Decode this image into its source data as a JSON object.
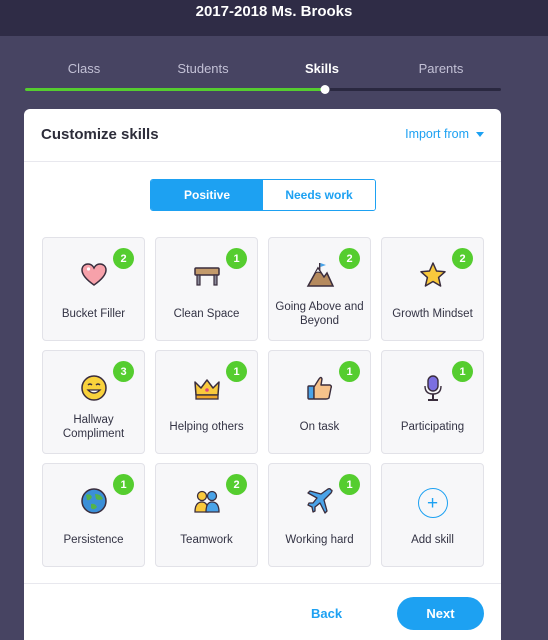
{
  "header": {
    "title": "2017-2018 Ms. Brooks"
  },
  "steps": {
    "items": [
      {
        "label": "Class"
      },
      {
        "label": "Students"
      },
      {
        "label": "Skills"
      },
      {
        "label": "Parents"
      }
    ],
    "active_index": 2,
    "progress_percent": 63
  },
  "card": {
    "title": "Customize skills",
    "import_label": "Import from",
    "toggle": {
      "positive_label": "Positive",
      "needs_work_label": "Needs work",
      "selected": "Positive"
    },
    "skills": [
      {
        "label": "Bucket Filler",
        "points": "2",
        "icon": "heart-icon"
      },
      {
        "label": "Clean Space",
        "points": "1",
        "icon": "desk-icon"
      },
      {
        "label": "Going Above and Beyond",
        "points": "2",
        "icon": "mountain-icon"
      },
      {
        "label": "Growth Mindset",
        "points": "2",
        "icon": "star-icon"
      },
      {
        "label": "Hallway Compliment",
        "points": "3",
        "icon": "smiley-icon"
      },
      {
        "label": "Helping others",
        "points": "1",
        "icon": "crown-icon"
      },
      {
        "label": "On task",
        "points": "1",
        "icon": "thumbs-up-icon"
      },
      {
        "label": "Participating",
        "points": "1",
        "icon": "microphone-icon"
      },
      {
        "label": "Persistence",
        "points": "1",
        "icon": "globe-icon"
      },
      {
        "label": "Teamwork",
        "points": "2",
        "icon": "team-icon"
      },
      {
        "label": "Working hard",
        "points": "1",
        "icon": "airplane-icon"
      }
    ],
    "add_skill_label": "Add skill",
    "add_icon": "plus-icon",
    "back_label": "Back",
    "next_label": "Next"
  },
  "colors": {
    "accent": "#1da1f2",
    "badge": "#55cd2f",
    "progress": "#55cd2f",
    "header_bg": "#2f2c46",
    "page_bg": "#474462"
  }
}
